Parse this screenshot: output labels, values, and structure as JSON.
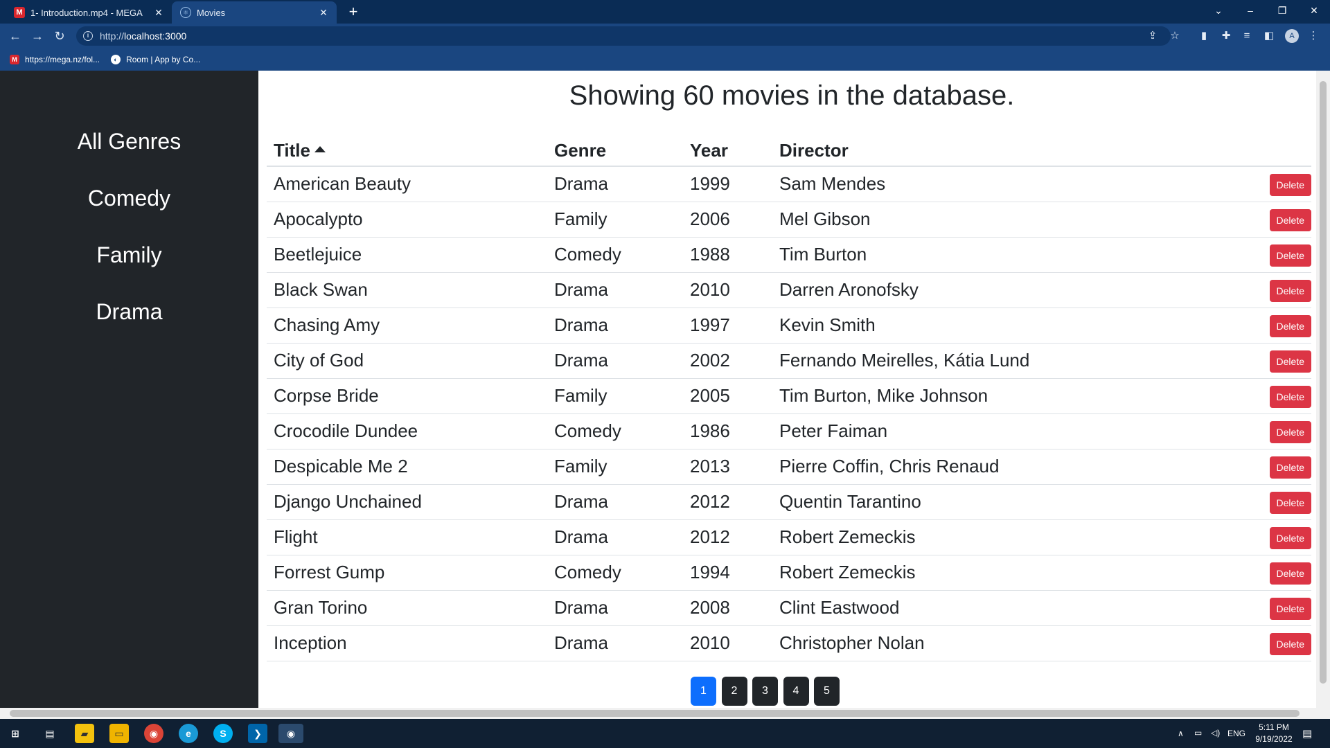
{
  "browser": {
    "tabs": [
      {
        "title": "1- Introduction.mp4 - MEGA",
        "favicon": "mega-icon",
        "active": false
      },
      {
        "title": "Movies",
        "favicon": "react-icon",
        "active": true
      }
    ],
    "url_scheme": "http://",
    "url_host": "localhost:3000",
    "bookmarks": [
      {
        "label": "https://mega.nz/fol...",
        "favicon": "mega-icon"
      },
      {
        "label": "Room | App by Co...",
        "favicon": "room-icon"
      }
    ],
    "profile_initial": "A"
  },
  "sidebar": {
    "genres": [
      "All Genres",
      "Comedy",
      "Family",
      "Drama"
    ]
  },
  "main": {
    "heading": "Showing 60 movies in the database.",
    "columns": {
      "title": "Title",
      "genre": "Genre",
      "year": "Year",
      "director": "Director"
    },
    "sort": {
      "column": "title",
      "order": "asc"
    },
    "delete_label": "Delete",
    "movies": [
      {
        "title": "American Beauty",
        "genre": "Drama",
        "year": "1999",
        "director": "Sam Mendes"
      },
      {
        "title": "Apocalypto",
        "genre": "Family",
        "year": "2006",
        "director": "Mel Gibson"
      },
      {
        "title": "Beetlejuice",
        "genre": "Comedy",
        "year": "1988",
        "director": "Tim Burton"
      },
      {
        "title": "Black Swan",
        "genre": "Drama",
        "year": "2010",
        "director": "Darren Aronofsky"
      },
      {
        "title": "Chasing Amy",
        "genre": "Drama",
        "year": "1997",
        "director": "Kevin Smith"
      },
      {
        "title": "City of God",
        "genre": "Drama",
        "year": "2002",
        "director": "Fernando Meirelles, Kátia Lund"
      },
      {
        "title": "Corpse Bride",
        "genre": "Family",
        "year": "2005",
        "director": "Tim Burton, Mike Johnson"
      },
      {
        "title": "Crocodile Dundee",
        "genre": "Comedy",
        "year": "1986",
        "director": "Peter Faiman"
      },
      {
        "title": "Despicable Me 2",
        "genre": "Family",
        "year": "2013",
        "director": "Pierre Coffin, Chris Renaud"
      },
      {
        "title": "Django Unchained",
        "genre": "Drama",
        "year": "2012",
        "director": "Quentin Tarantino"
      },
      {
        "title": "Flight",
        "genre": "Drama",
        "year": "2012",
        "director": "Robert Zemeckis"
      },
      {
        "title": "Forrest Gump",
        "genre": "Comedy",
        "year": "1994",
        "director": "Robert Zemeckis"
      },
      {
        "title": "Gran Torino",
        "genre": "Drama",
        "year": "2008",
        "director": "Clint Eastwood"
      },
      {
        "title": "Inception",
        "genre": "Drama",
        "year": "2010",
        "director": "Christopher Nolan"
      }
    ],
    "pagination": {
      "pages": [
        "1",
        "2",
        "3",
        "4",
        "5"
      ],
      "current": "1"
    }
  },
  "colors": {
    "sidebar_bg": "#212529",
    "delete_button": "#dc3545",
    "page_active": "#0d6efd",
    "page_inactive": "#212529"
  },
  "taskbar": {
    "language": "ENG",
    "time": "5:11 PM",
    "date": "9/19/2022"
  }
}
